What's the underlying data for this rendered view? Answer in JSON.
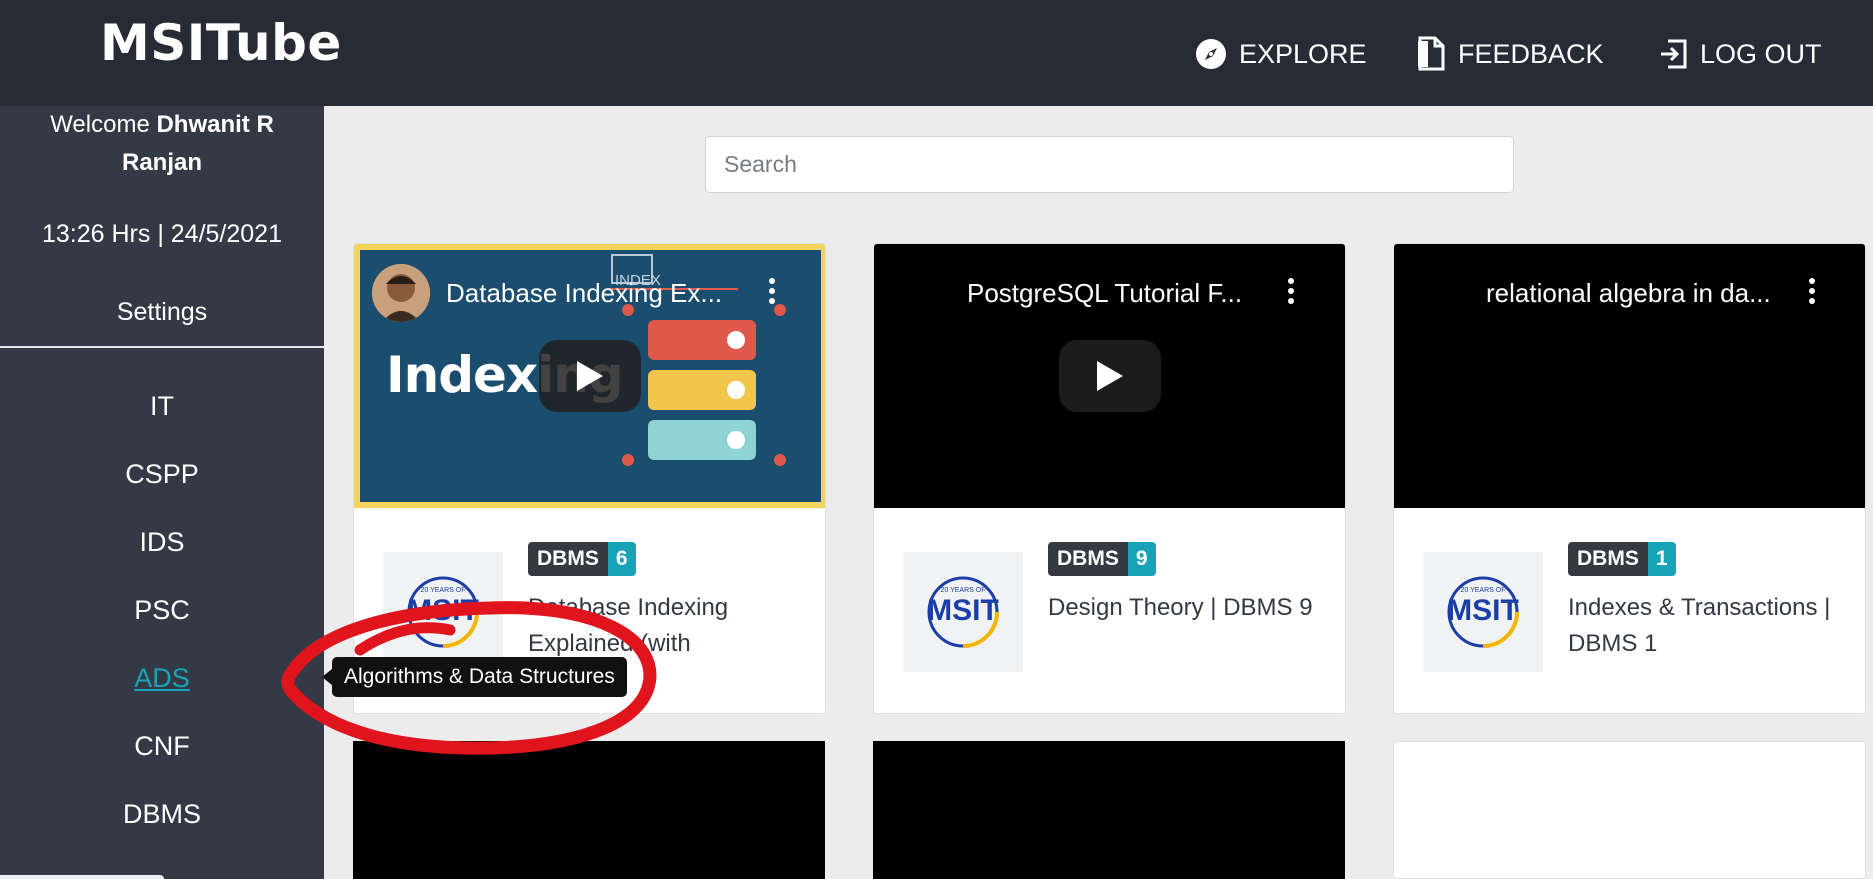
{
  "app": {
    "title": "MSITube"
  },
  "nav": {
    "explore": "EXPLORE",
    "feedback": "FEEDBACK",
    "logout": "LOG OUT"
  },
  "sidebar": {
    "welcome_prefix": "Welcome",
    "user_name": "Dhwanit R Ranjan",
    "datetime": "13:26 Hrs | 24/5/2021",
    "settings": "Settings",
    "subjects": [
      "IT",
      "CSPP",
      "IDS",
      "PSC",
      "ADS",
      "CNF",
      "DBMS"
    ],
    "active_subject": "ADS"
  },
  "tooltip": {
    "text": "Algorithms & Data Structures"
  },
  "search": {
    "placeholder": "Search",
    "value": ""
  },
  "videos": [
    {
      "yt_title": "Database Indexing Ex...",
      "thumbnail_text": "Indexing",
      "thumbnail_badge": "INDEX",
      "subject": "DBMS",
      "number": "6",
      "title_line1": "Database Indexing",
      "title_line2": "Explained (with"
    },
    {
      "yt_title": "PostgreSQL Tutorial F...",
      "subject": "DBMS",
      "number": "9",
      "title_line1": "Design Theory | DBMS 9",
      "title_line2": ""
    },
    {
      "yt_title": "relational algebra in da...",
      "subject": "DBMS",
      "number": "1",
      "title_line1": "Indexes & Transactions |",
      "title_line2": "DBMS 1"
    }
  ],
  "logo": {
    "text": "MSIT",
    "tagline": "20 YEARS OF"
  },
  "colors": {
    "navbar": "#262b35",
    "sidebar": "#343a45",
    "accent": "#17a2b8",
    "badge_dark": "#343a40",
    "annotation": "#e0141c"
  }
}
